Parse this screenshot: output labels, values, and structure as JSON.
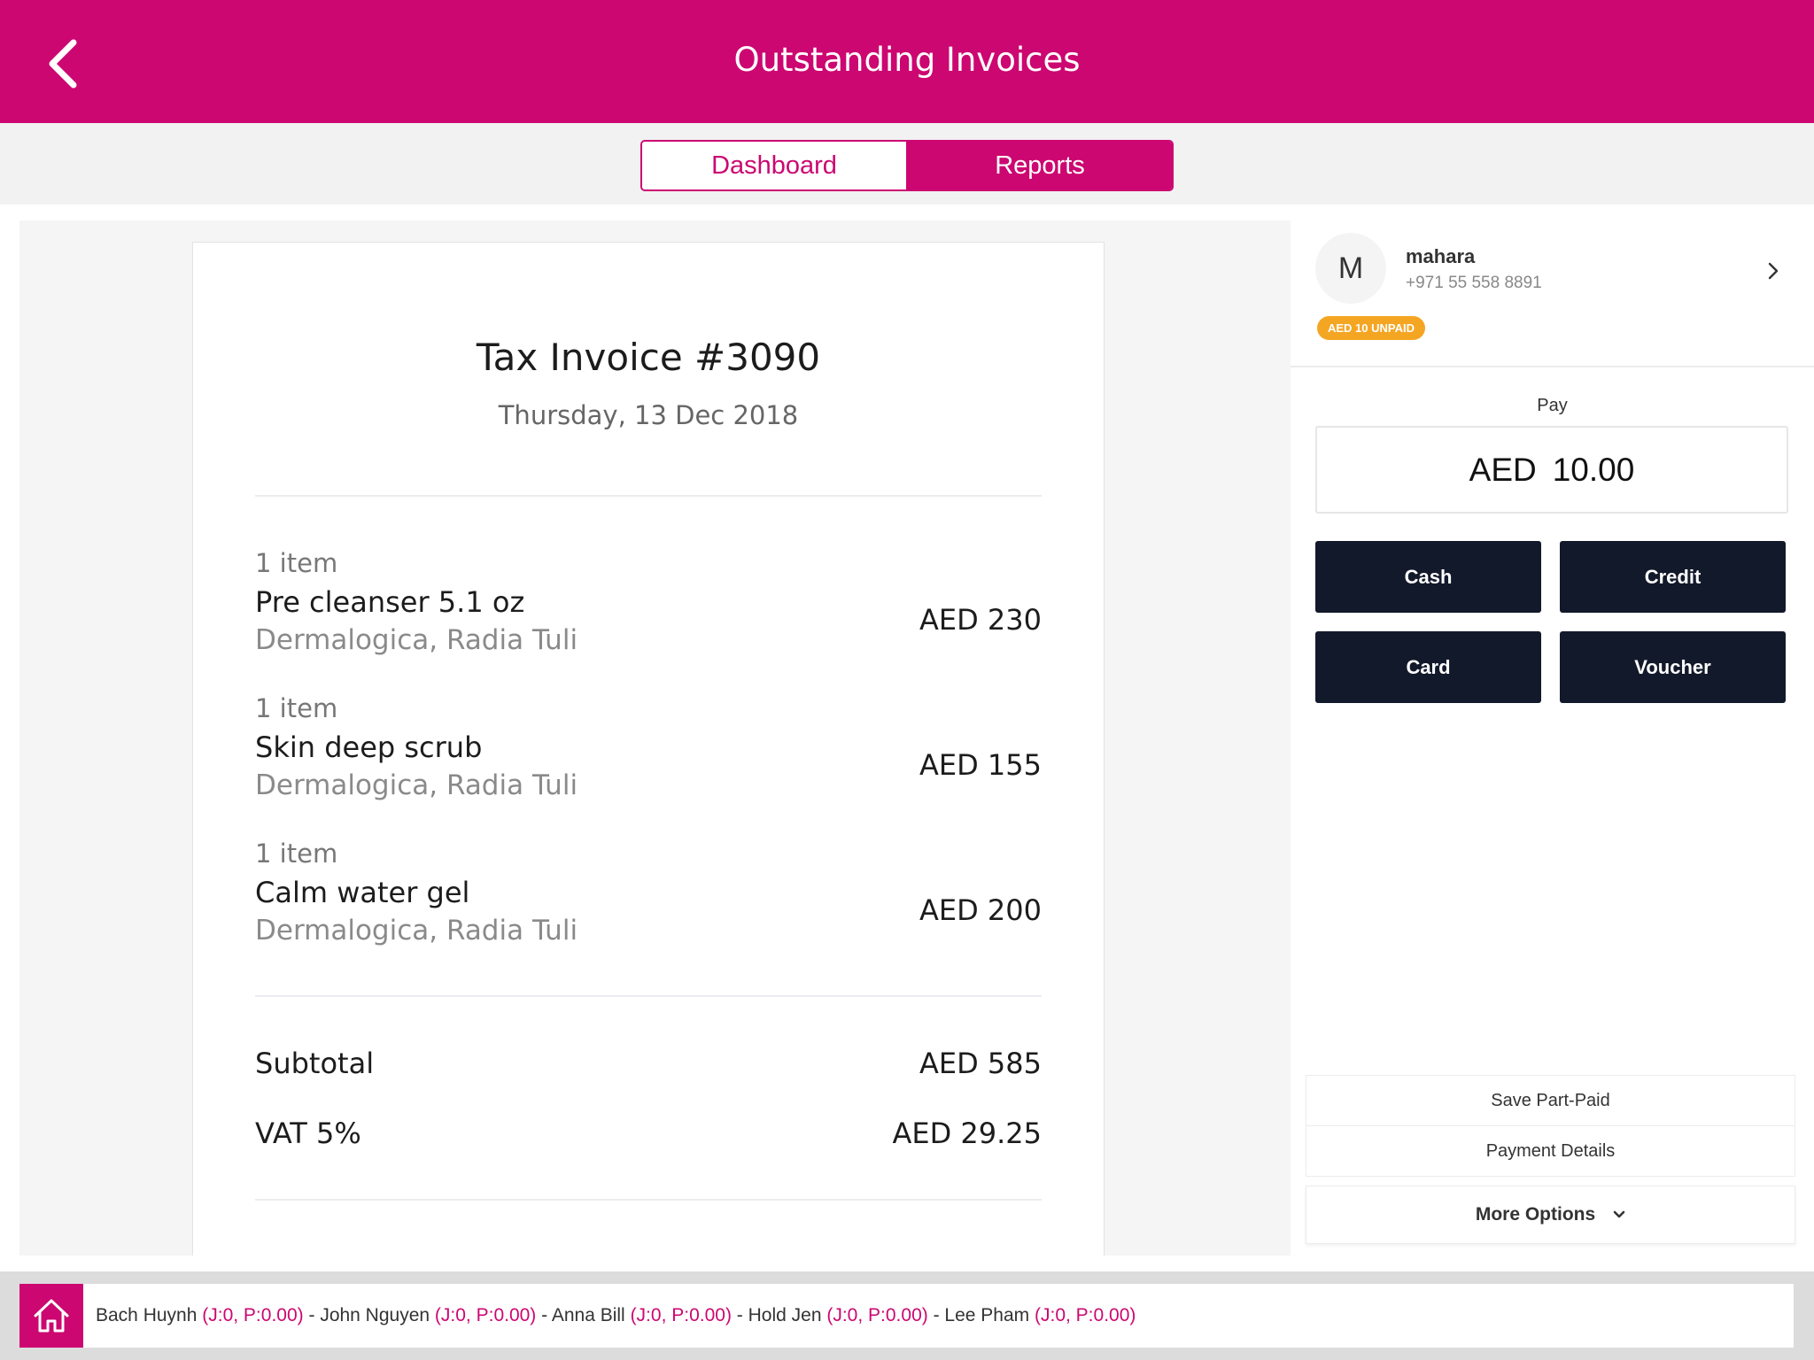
{
  "header": {
    "title": "Outstanding Invoices",
    "back_icon": "chevron-left-icon"
  },
  "tabs": [
    {
      "label": "Dashboard",
      "active": false
    },
    {
      "label": "Reports",
      "active": true
    }
  ],
  "invoice": {
    "title": "Tax Invoice #3090",
    "date": "Thursday, 13 Dec 2018",
    "items": [
      {
        "qty": "1 item",
        "name": "Pre cleanser 5.1 oz",
        "meta": "Dermalogica, Radia Tuli",
        "price": "AED 230"
      },
      {
        "qty": "1 item",
        "name": "Skin deep scrub",
        "meta": "Dermalogica, Radia Tuli",
        "price": "AED 155"
      },
      {
        "qty": "1 item",
        "name": "Calm water gel",
        "meta": "Dermalogica, Radia Tuli",
        "price": "AED 200"
      }
    ],
    "subtotal_label": "Subtotal",
    "subtotal_value": "AED 585",
    "vat_label": "VAT 5%",
    "vat_value": "AED 29.25"
  },
  "client": {
    "initial": "M",
    "name": "mahara",
    "phone": "+971 55 558 8891",
    "badge": "AED 10 UNPAID"
  },
  "payment": {
    "label": "Pay",
    "currency": "AED",
    "amount": "10.00",
    "methods": [
      "Cash",
      "Credit",
      "Card",
      "Voucher"
    ]
  },
  "options": {
    "save_part_paid": "Save Part-Paid",
    "payment_details": "Payment Details",
    "more_options": "More Options"
  },
  "staff": [
    {
      "name": "Bach Huynh",
      "stat": "(J:0, P:0.00)"
    },
    {
      "name": "John Nguyen",
      "stat": "(J:0, P:0.00)"
    },
    {
      "name": "Anna Bill",
      "stat": "(J:0, P:0.00)"
    },
    {
      "name": "Hold Jen",
      "stat": "(J:0, P:0.00)"
    },
    {
      "name": "Lee Pham",
      "stat": "(J:0, P:0.00)"
    }
  ],
  "colors": {
    "brand": "#cc0771",
    "dark_button": "#12192a",
    "badge": "#f4a623"
  }
}
